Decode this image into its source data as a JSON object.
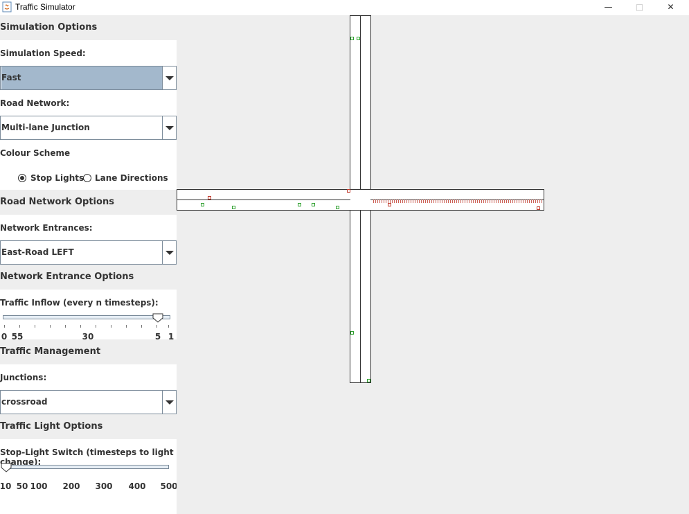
{
  "window": {
    "title": "Traffic Simulator"
  },
  "sections": {
    "simulation_options": "Simulation Options",
    "road_network_options": "Road Network Options",
    "network_entrance_options": "Network Entrance Options",
    "traffic_management": "Traffic Management",
    "traffic_light_options": "Traffic Light Options"
  },
  "simulation_speed": {
    "label": "Simulation Speed:",
    "value": "Fast"
  },
  "road_network": {
    "label": "Road Network:",
    "value": "Multi-lane Junction"
  },
  "colour_scheme": {
    "label": "Colour Scheme",
    "options": [
      "Stop Lights",
      "Lane Directions"
    ],
    "selected": "Stop Lights"
  },
  "network_entrances": {
    "label": "Network Entrances:",
    "value": "East-Road LEFT"
  },
  "traffic_inflow": {
    "label": "Traffic Inflow (every n timesteps):",
    "tick_labels": [
      "0",
      "55",
      "30",
      "5",
      "1"
    ],
    "value": "5"
  },
  "junctions": {
    "label": "Junctions:",
    "value": "crossroad"
  },
  "stop_light_switch": {
    "label": "Stop-Light Switch (timesteps to light change):",
    "tick_labels": [
      "10",
      "50",
      "100",
      "200",
      "300",
      "400",
      "500"
    ],
    "value": "10"
  },
  "colors": {
    "car_moving": "#2da02d",
    "car_stopped": "#c0392b",
    "selection": "#a3b8cc"
  }
}
